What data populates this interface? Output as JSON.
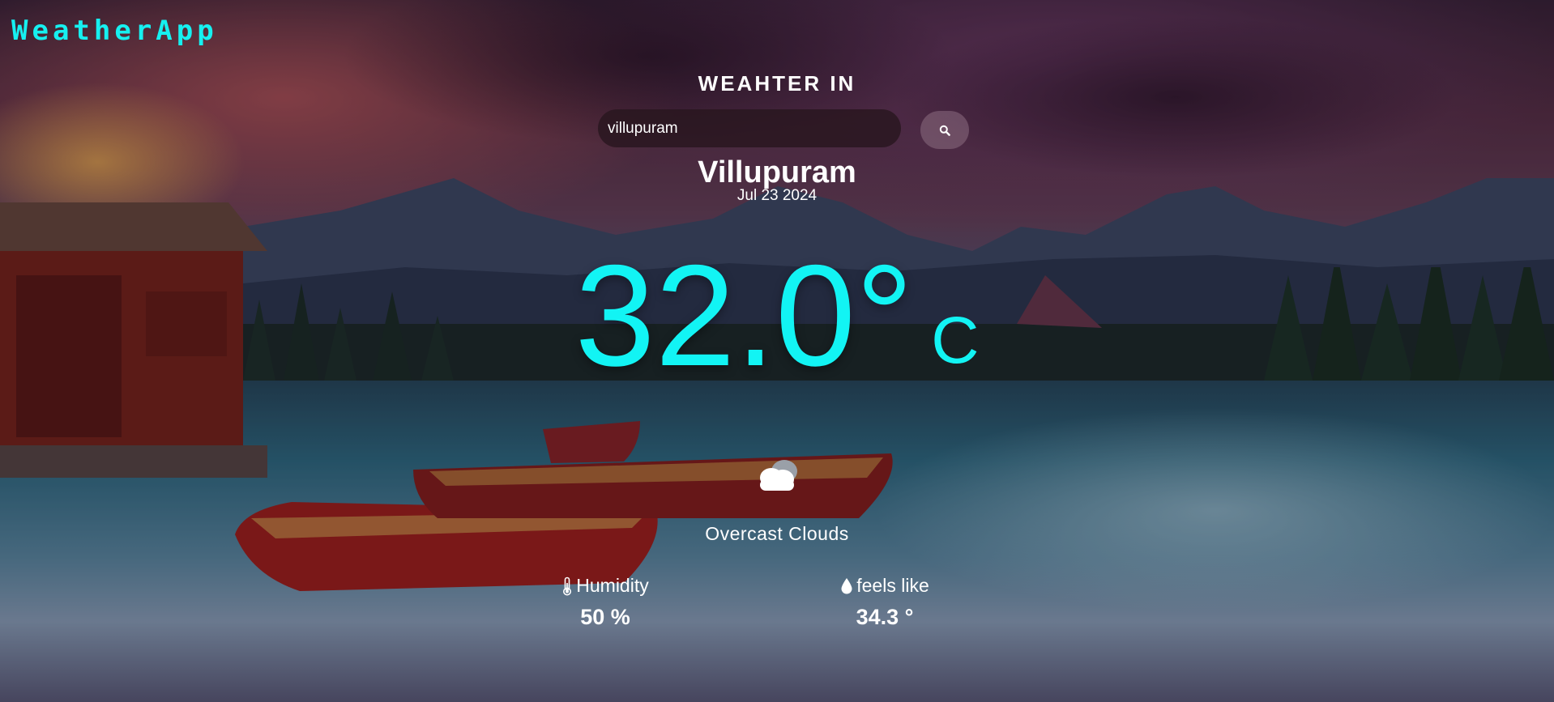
{
  "app": {
    "logo": "WeatherApp"
  },
  "search": {
    "heading": "WEAHTER IN",
    "value": "villupuram",
    "button_icon": "search-icon"
  },
  "location": {
    "city": "Villupuram",
    "date": "Jul 23 2024"
  },
  "current": {
    "temperature": "32.0°",
    "unit": "C",
    "condition_icon": "cloud-icon",
    "condition": "Overcast Clouds"
  },
  "stats": {
    "humidity": {
      "icon": "thermometer-icon",
      "label": "Humidity",
      "value": "50 %"
    },
    "feels_like": {
      "icon": "droplet-icon",
      "label": "feels like",
      "value": "34.3 °"
    }
  },
  "colors": {
    "accent": "#12f4f4",
    "text": "#ffffff"
  }
}
